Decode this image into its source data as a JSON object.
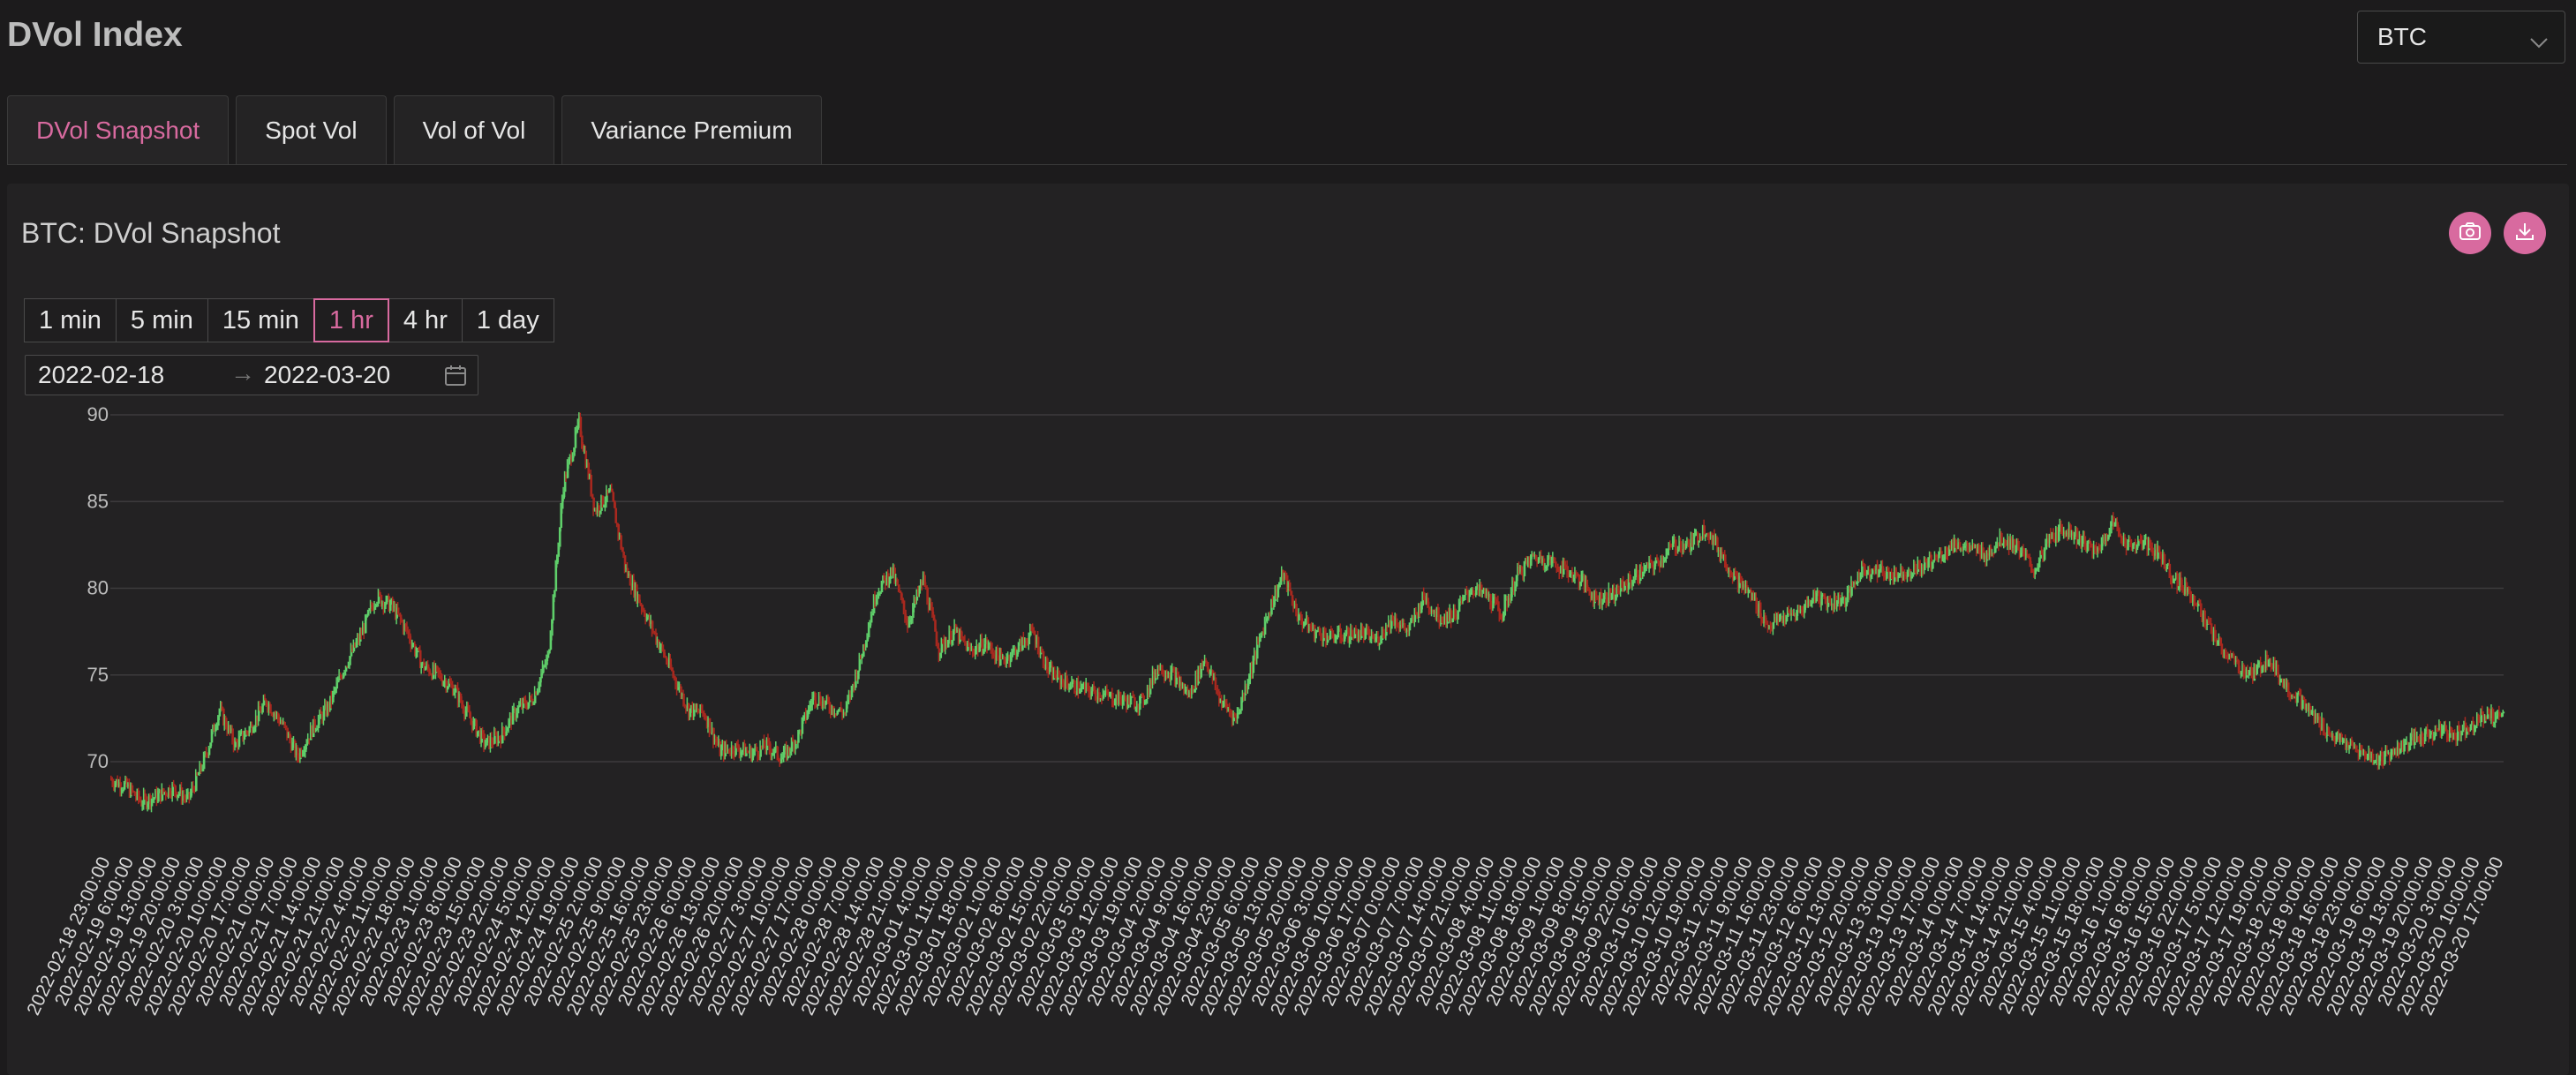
{
  "page_title": "DVol Index",
  "asset_select": {
    "value": "BTC"
  },
  "tabs": [
    {
      "label": "DVol Snapshot",
      "active": true
    },
    {
      "label": "Spot Vol"
    },
    {
      "label": "Vol of Vol"
    },
    {
      "label": "Variance Premium"
    }
  ],
  "panel": {
    "title": "BTC: DVol Snapshot",
    "icons": [
      "camera-icon",
      "download-icon"
    ]
  },
  "intervals": [
    "1 min",
    "5 min",
    "15 min",
    "1 hr",
    "4 hr",
    "1 day"
  ],
  "active_interval": "1 hr",
  "date_range": {
    "start": "2022-02-18",
    "end": "2022-03-20",
    "separator": "→"
  },
  "colors": {
    "accent": "#d86a9f",
    "up": "#5fcf6a",
    "down": "#a8281f"
  },
  "chart_data": {
    "type": "candlestick",
    "ylim": [
      66,
      90
    ],
    "yticks": [
      70,
      75,
      80,
      85,
      90
    ],
    "grid": true,
    "xticks": [
      "2022-02-18 23:00:00",
      "2022-02-19 6:00:00",
      "2022-02-19 13:00:00",
      "2022-02-19 20:00:00",
      "2022-02-20 3:00:00",
      "2022-02-20 10:00:00",
      "2022-02-20 17:00:00",
      "2022-02-21 0:00:00",
      "2022-02-21 7:00:00",
      "2022-02-21 14:00:00",
      "2022-02-21 21:00:00",
      "2022-02-22 4:00:00",
      "2022-02-22 11:00:00",
      "2022-02-22 18:00:00",
      "2022-02-23 1:00:00",
      "2022-02-23 8:00:00",
      "2022-02-23 15:00:00",
      "2022-02-23 22:00:00",
      "2022-02-24 5:00:00",
      "2022-02-24 12:00:00",
      "2022-02-24 19:00:00",
      "2022-02-25 2:00:00",
      "2022-02-25 9:00:00",
      "2022-02-25 16:00:00",
      "2022-02-25 23:00:00",
      "2022-02-26 6:00:00",
      "2022-02-26 13:00:00",
      "2022-02-26 20:00:00",
      "2022-02-27 3:00:00",
      "2022-02-27 10:00:00",
      "2022-02-27 17:00:00",
      "2022-02-28 0:00:00",
      "2022-02-28 7:00:00",
      "2022-02-28 14:00:00",
      "2022-02-28 21:00:00",
      "2022-03-01 4:00:00",
      "2022-03-01 11:00:00",
      "2022-03-01 18:00:00",
      "2022-03-02 1:00:00",
      "2022-03-02 8:00:00",
      "2022-03-02 15:00:00",
      "2022-03-02 22:00:00",
      "2022-03-03 5:00:00",
      "2022-03-03 12:00:00",
      "2022-03-03 19:00:00",
      "2022-03-04 2:00:00",
      "2022-03-04 9:00:00",
      "2022-03-04 16:00:00",
      "2022-03-04 23:00:00",
      "2022-03-05 6:00:00",
      "2022-03-05 13:00:00",
      "2022-03-05 20:00:00",
      "2022-03-06 3:00:00",
      "2022-03-06 10:00:00",
      "2022-03-06 17:00:00",
      "2022-03-07 0:00:00",
      "2022-03-07 7:00:00",
      "2022-03-07 14:00:00",
      "2022-03-07 21:00:00",
      "2022-03-08 4:00:00",
      "2022-03-08 11:00:00",
      "2022-03-08 18:00:00",
      "2022-03-09 1:00:00",
      "2022-03-09 8:00:00",
      "2022-03-09 15:00:00",
      "2022-03-09 22:00:00",
      "2022-03-10 5:00:00",
      "2022-03-10 12:00:00",
      "2022-03-10 19:00:00",
      "2022-03-11 2:00:00",
      "2022-03-11 9:00:00",
      "2022-03-11 16:00:00",
      "2022-03-11 23:00:00",
      "2022-03-12 6:00:00",
      "2022-03-12 13:00:00",
      "2022-03-12 20:00:00",
      "2022-03-13 3:00:00",
      "2022-03-13 10:00:00",
      "2022-03-13 17:00:00",
      "2022-03-14 0:00:00",
      "2022-03-14 7:00:00",
      "2022-03-14 14:00:00",
      "2022-03-14 21:00:00",
      "2022-03-15 4:00:00",
      "2022-03-15 11:00:00",
      "2022-03-15 18:00:00",
      "2022-03-16 1:00:00",
      "2022-03-16 8:00:00",
      "2022-03-16 15:00:00",
      "2022-03-16 22:00:00",
      "2022-03-17 5:00:00",
      "2022-03-17 12:00:00",
      "2022-03-17 19:00:00",
      "2022-03-18 2:00:00",
      "2022-03-18 9:00:00",
      "2022-03-18 16:00:00",
      "2022-03-18 23:00:00",
      "2022-03-19 6:00:00",
      "2022-03-19 13:00:00",
      "2022-03-19 20:00:00",
      "2022-03-20 3:00:00",
      "2022-03-20 10:00:00",
      "2022-03-20 17:00:00"
    ],
    "close_series": [
      69,
      68.6,
      67.7,
      68,
      68.5,
      67.8,
      70,
      73,
      71,
      72,
      73.5,
      72.2,
      70.3,
      72,
      73.2,
      75.5,
      77.2,
      79.5,
      79,
      77.5,
      75.5,
      75,
      74.2,
      72.5,
      71,
      71.5,
      73,
      73.6,
      76,
      86,
      89.5,
      84.5,
      85.5,
      81,
      79,
      77,
      75,
      73,
      72.8,
      70.6,
      70.8,
      70.5,
      70.9,
      70.2,
      71.5,
      73.8,
      73.2,
      72.8,
      76,
      79.8,
      81,
      78,
      80.5,
      76.5,
      77.5,
      76.4,
      76.8,
      75.8,
      76.5,
      77.5,
      75.2,
      74.6,
      74.2,
      74,
      73.7,
      73.5,
      73.4,
      75.5,
      75,
      73.8,
      76,
      73.5,
      72.5,
      75.5,
      78.5,
      80.8,
      78.3,
      77.5,
      77.2,
      77.3,
      77.4,
      77,
      78.3,
      77.5,
      79.5,
      78.3,
      78.5,
      80,
      79.6,
      78.5,
      80.8,
      81.8,
      81.6,
      81.1,
      80.5,
      79.4,
      79.6,
      80.3,
      81,
      81.5,
      82.5,
      82.5,
      83.5,
      82,
      80.5,
      79.5,
      77.8,
      78.3,
      78.6,
      79.6,
      79.2,
      79.4,
      81.1,
      81,
      80.8,
      81,
      81.3,
      81.9,
      82.6,
      82.2,
      82,
      82.9,
      82.3,
      81,
      82.8,
      83.5,
      82.8,
      82,
      83.8,
      82.5,
      82.6,
      82,
      80.5,
      79.8,
      78,
      76.5,
      75.5,
      75,
      76,
      74.5,
      73.5,
      72.5,
      71.5,
      71,
      70.5,
      70.1,
      70.6,
      71.1,
      71.5,
      71.8,
      71.6,
      72.2,
      72.7,
      72.6
    ]
  }
}
